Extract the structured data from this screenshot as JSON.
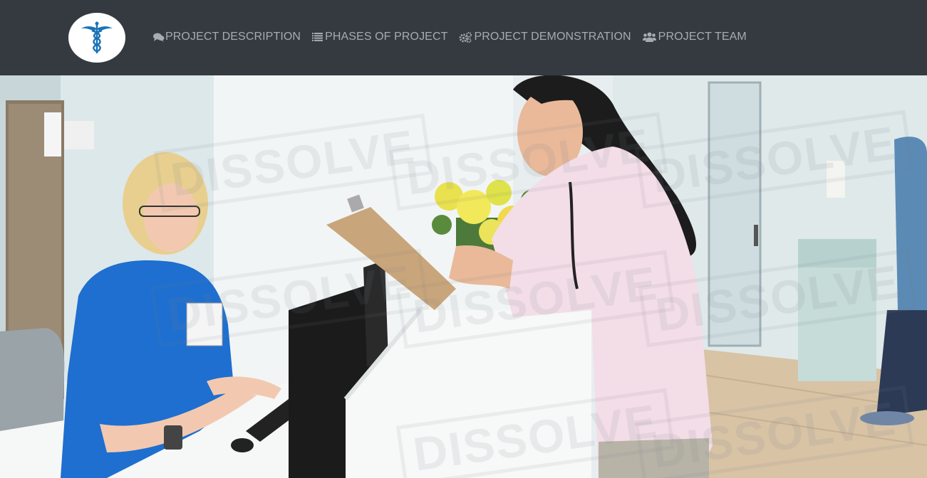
{
  "navbar": {
    "logo_icon": "caduceus-icon",
    "colors": {
      "background": "#343a40",
      "link": "#a8abb0",
      "logo_bg": "#ffffff",
      "logo_accent": "#1a73b5"
    },
    "links": [
      {
        "icon": "comments-icon",
        "label": "PROJECT DESCRIPTION"
      },
      {
        "icon": "list-icon",
        "label": "PHASES OF PROJECT"
      },
      {
        "icon": "cogs-icon",
        "label": "PROJECT DEMONSTRATION"
      },
      {
        "icon": "users-icon",
        "label": "PROJECT TEAM"
      }
    ]
  },
  "hero": {
    "image": "hospital-reception-photo",
    "watermark": "DISSOLVE"
  }
}
